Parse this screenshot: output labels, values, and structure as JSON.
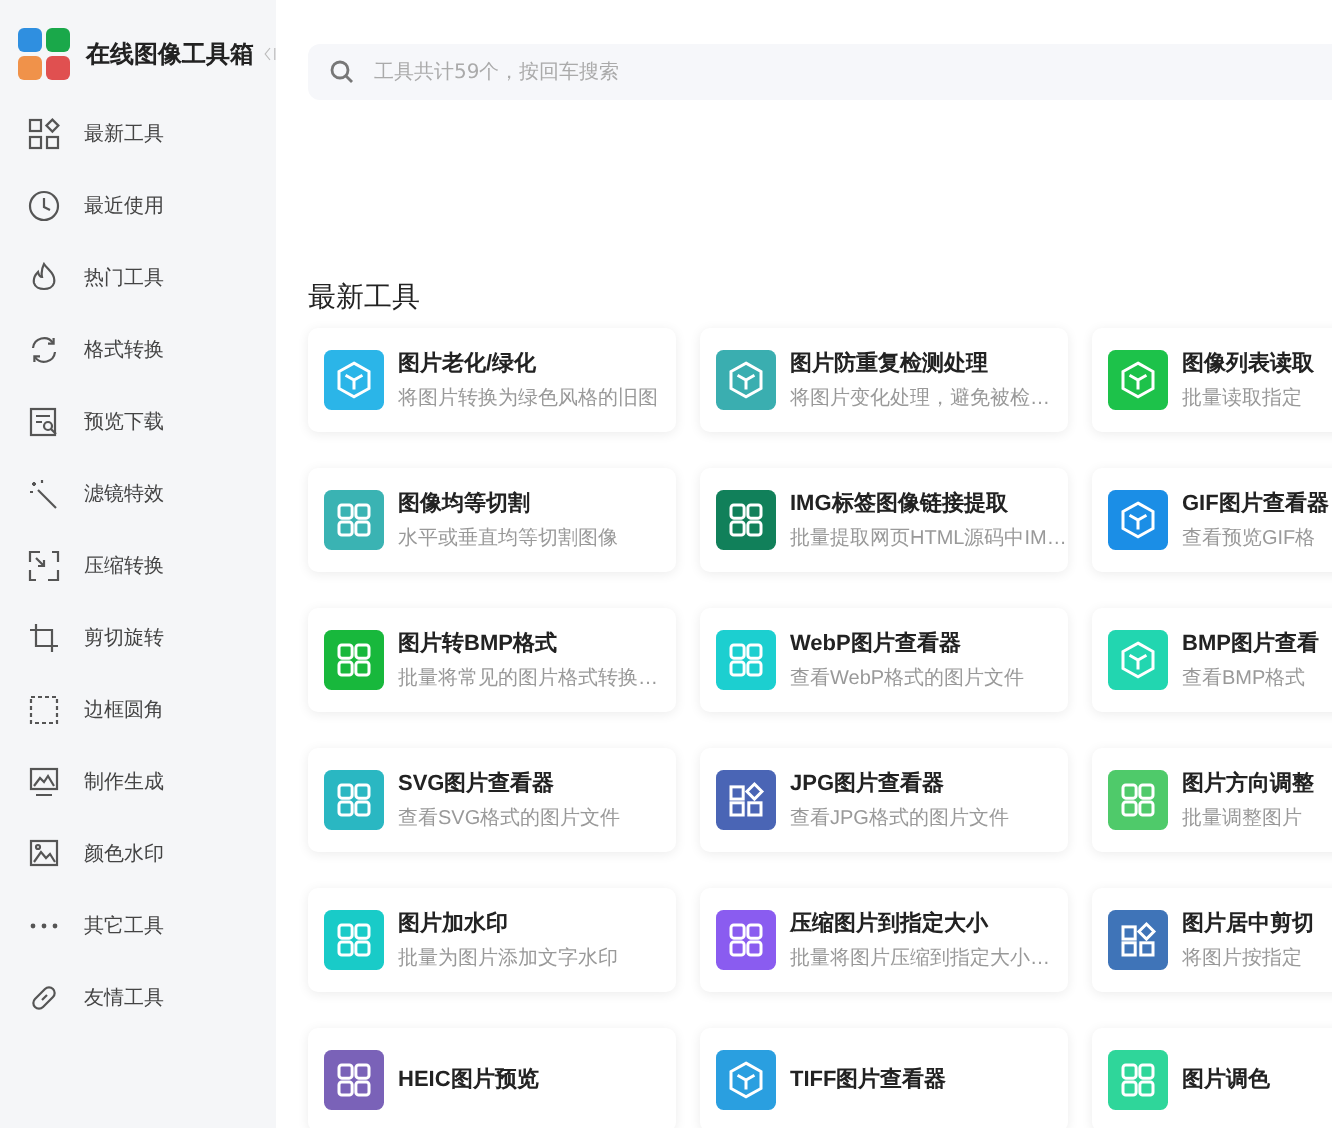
{
  "app": {
    "title": "在线图像工具箱"
  },
  "sidebar": {
    "items": [
      {
        "label": "最新工具"
      },
      {
        "label": "最近使用"
      },
      {
        "label": "热门工具"
      },
      {
        "label": "格式转换"
      },
      {
        "label": "预览下载"
      },
      {
        "label": "滤镜特效"
      },
      {
        "label": "压缩转换"
      },
      {
        "label": "剪切旋转"
      },
      {
        "label": "边框圆角"
      },
      {
        "label": "制作生成"
      },
      {
        "label": "颜色水印"
      },
      {
        "label": "其它工具"
      },
      {
        "label": "友情工具"
      }
    ]
  },
  "search": {
    "placeholder": "工具共计59个，按回车搜索"
  },
  "section": {
    "title": "最新工具"
  },
  "tools": [
    {
      "title": "图片老化/绿化",
      "desc": "将图片转换为绿色风格的旧图",
      "kind": "cube",
      "color": "#2bb5e8"
    },
    {
      "title": "图片防重复检测处理",
      "desc": "将图片变化处理，避免被检…",
      "kind": "cube",
      "color": "#3aaeb0"
    },
    {
      "title": "图像列表读取",
      "desc": "批量读取指定",
      "kind": "cube",
      "color": "#1dc24a"
    },
    {
      "title": "图像均等切割",
      "desc": "水平或垂直均等切割图像",
      "kind": "grid",
      "color": "#3ab3b3"
    },
    {
      "title": "IMG标签图像链接提取",
      "desc": "批量提取网页HTML源码中IM…",
      "kind": "grid",
      "color": "#11805a"
    },
    {
      "title": "GIF图片查看器",
      "desc": "查看预览GIF格",
      "kind": "cube",
      "color": "#1b8ee6"
    },
    {
      "title": "图片转BMP格式",
      "desc": "批量将常见的图片格式转换…",
      "kind": "grid",
      "color": "#18b83c"
    },
    {
      "title": "WebP图片查看器",
      "desc": "查看WebP格式的图片文件",
      "kind": "grid",
      "color": "#1ccfd0"
    },
    {
      "title": "BMP图片查看",
      "desc": "查看BMP格式",
      "kind": "cube",
      "color": "#22d6b0"
    },
    {
      "title": "SVG图片查看器",
      "desc": "查看SVG格式的图片文件",
      "kind": "grid",
      "color": "#2ab7c2"
    },
    {
      "title": "JPG图片查看器",
      "desc": "查看JPG格式的图片文件",
      "kind": "shapes",
      "color": "#4a65b5"
    },
    {
      "title": "图片方向调整",
      "desc": "批量调整图片",
      "kind": "grid",
      "color": "#4fca6a"
    },
    {
      "title": "图片加水印",
      "desc": "批量为图片添加文字水印",
      "kind": "grid",
      "color": "#19cbc8"
    },
    {
      "title": "压缩图片到指定大小",
      "desc": "批量将图片压缩到指定大小…",
      "kind": "grid",
      "color": "#8a5cf0"
    },
    {
      "title": "图片居中剪切",
      "desc": "将图片按指定",
      "kind": "shapes",
      "color": "#3f74b8"
    },
    {
      "title": "HEIC图片预览",
      "kind": "grid",
      "color": "#7a62b8"
    },
    {
      "title": "TIFF图片查看器",
      "kind": "cube",
      "color": "#2a9fe0"
    },
    {
      "title": "图片调色",
      "kind": "grid",
      "color": "#2fd69a"
    }
  ]
}
